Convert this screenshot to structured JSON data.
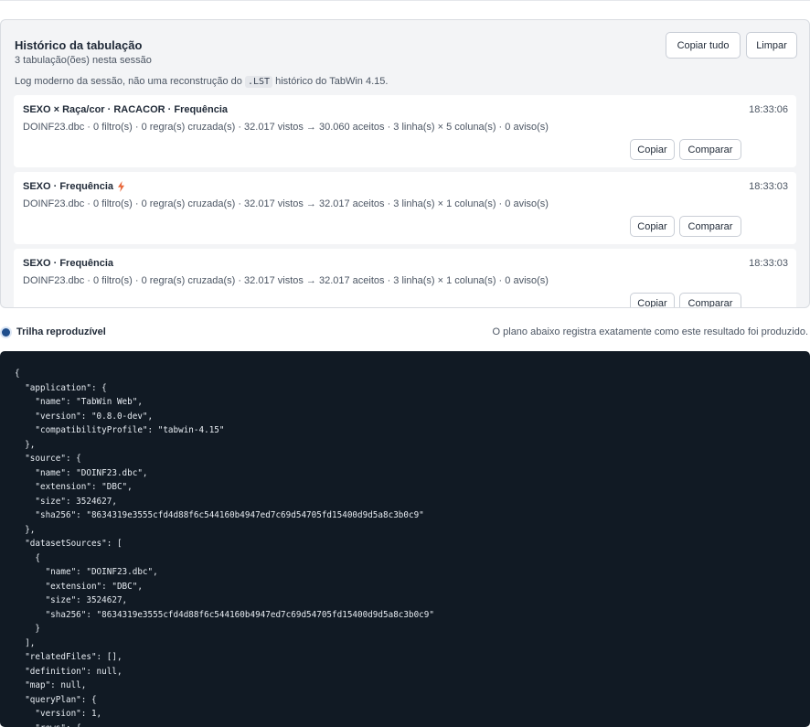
{
  "history": {
    "title": "Histórico da tabulação",
    "subtitle": "3 tabulação(ões) nesta sessão",
    "note_prefix": "Log moderno da sessão, não uma reconstrução do",
    "note_code": ".LST",
    "note_suffix": "histórico do TabWin 4.15.",
    "copy_all_label": "Copiar tudo",
    "clear_label": "Limpar",
    "entries": [
      {
        "title": "SEXO × Raça/cor · RACACOR · Frequência",
        "time": "18:33:06",
        "meta": "DOINF23.dbc · 0 filtro(s) · 0 regra(s) cruzada(s) · 32.017 vistos → 30.060 aceitos · 3 linha(s) × 5 coluna(s) · 0 aviso(s)",
        "copy_label": "Copiar",
        "compare_label": "Comparar",
        "icon": "lightning-icon",
        "has_icon": false
      },
      {
        "title": "SEXO · Frequência",
        "time": "18:33:03",
        "meta": "DOINF23.dbc · 0 filtro(s) · 0 regra(s) cruzada(s) · 32.017 vistos → 32.017 aceitos · 3 linha(s) × 1 coluna(s) · 0 aviso(s)",
        "copy_label": "Copiar",
        "compare_label": "Comparar",
        "icon": "lightning-icon",
        "has_icon": true
      },
      {
        "title": "SEXO · Frequência",
        "time": "18:33:03",
        "meta": "DOINF23.dbc · 0 filtro(s) · 0 regra(s) cruzada(s) · 32.017 vistos → 32.017 aceitos · 3 linha(s) × 1 coluna(s) · 0 aviso(s)",
        "copy_label": "Copiar",
        "compare_label": "Comparar",
        "icon": "lightning-icon",
        "has_icon": false
      }
    ]
  },
  "trail": {
    "label": "Trilha reproduzível",
    "caption": "O plano abaixo registra exatamente como este resultado foi produzido."
  },
  "code": {
    "text": "{\n  \"application\": {\n    \"name\": \"TabWin Web\",\n    \"version\": \"0.8.0-dev\",\n    \"compatibilityProfile\": \"tabwin-4.15\"\n  },\n  \"source\": {\n    \"name\": \"DOINF23.dbc\",\n    \"extension\": \"DBC\",\n    \"size\": 3524627,\n    \"sha256\": \"8634319e3555cfd4d88f6c544160b4947ed7c69d54705fd15400d9d5a8c3b0c9\"\n  },\n  \"datasetSources\": [\n    {\n      \"name\": \"DOINF23.dbc\",\n      \"extension\": \"DBC\",\n      \"size\": 3524627,\n      \"sha256\": \"8634319e3555cfd4d88f6c544160b4947ed7c69d54705fd15400d9d5a8c3b0c9\"\n    }\n  ],\n  \"relatedFiles\": [],\n  \"definition\": null,\n  \"map\": null,\n  \"queryPlan\": {\n    \"version\": 1,\n    \"rows\": {"
  },
  "colors": {
    "accent": "#1f4e8c",
    "bolt": "#e8673a",
    "code_bg": "#111a24",
    "panel_bg": "#f3f4f6"
  }
}
